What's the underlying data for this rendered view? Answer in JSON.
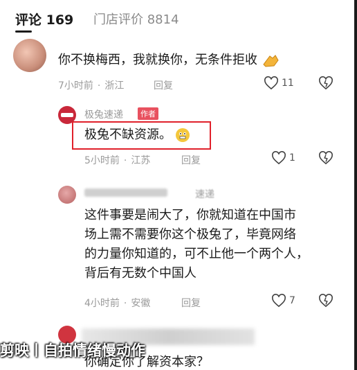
{
  "tabs": {
    "active": "评论 169",
    "inactive": "门店评价 8814"
  },
  "comments": [
    {
      "text": "你不换梅西，我就换你，无条件拒收",
      "time": "7小时前",
      "location": "浙江",
      "reply_label": "回复",
      "likes": "11"
    },
    {
      "author": "极兔速递",
      "author_tag": "作者",
      "text": "极兔不缺资源。",
      "time": "5小时前",
      "location": "江苏",
      "reply_label": "回复",
      "likes": "1"
    },
    {
      "author_suffix": "速递",
      "lines": [
        "这件事要是闹大了，你就知道在中国市",
        "场上需不需要你这个极兔了，毕竟网络",
        "的力量你知道的，可不止他一个两个人，",
        "背后有无数个中国人"
      ],
      "time": "4小时前",
      "location": "安徽",
      "reply_label": "回复",
      "likes": "7"
    },
    {
      "text_partial": "你确定你了解资本家？"
    }
  ],
  "watermark": "剪映丨自拍情绪慢动作",
  "colors": {
    "highlight": "#e0202a",
    "author_tag": "#e8515f",
    "brand_red": "#c9283a"
  }
}
